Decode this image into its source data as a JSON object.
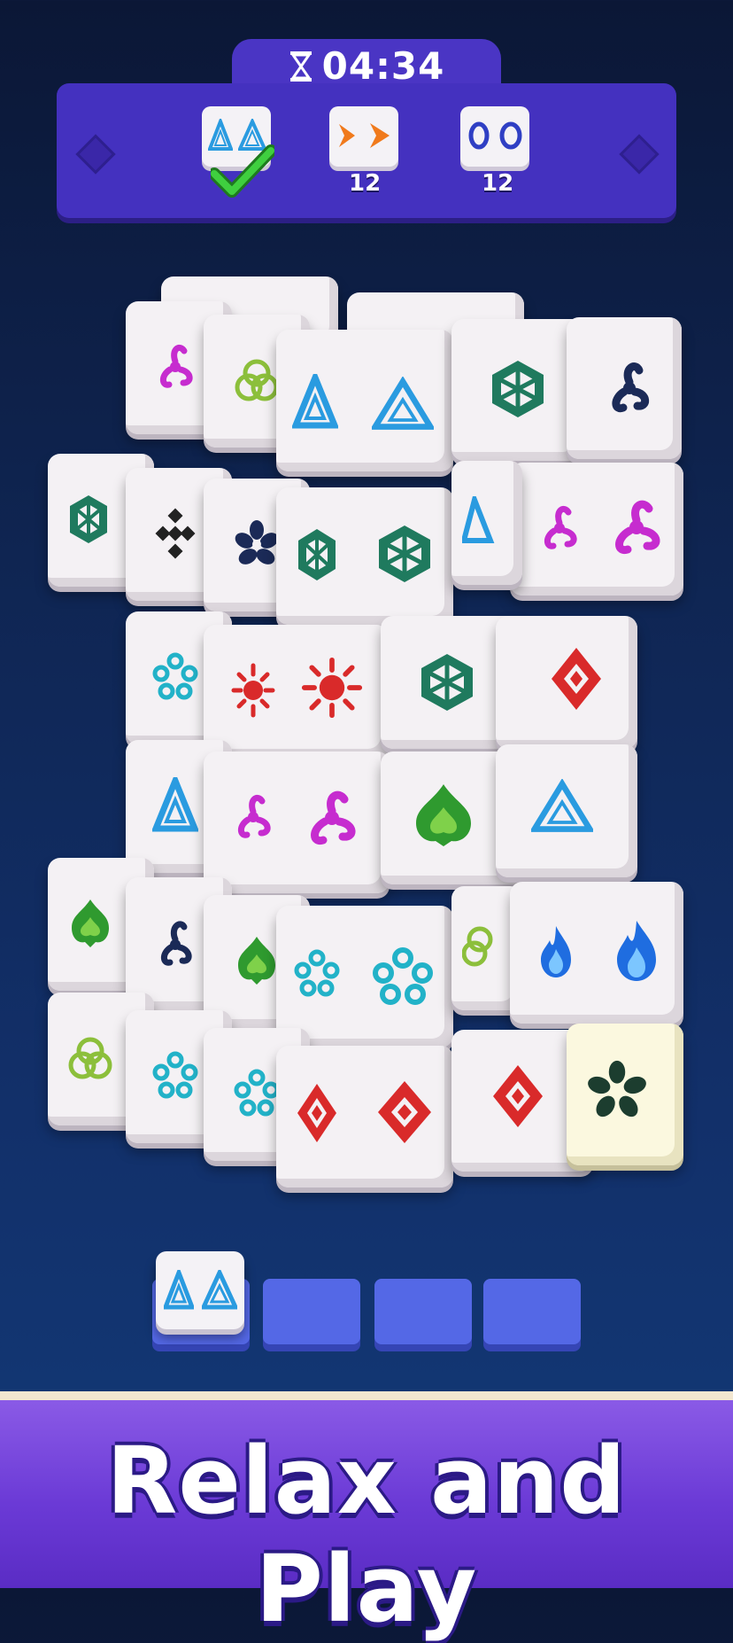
{
  "hud": {
    "timer": "04:34",
    "timer_icon": "hourglass-icon",
    "goals": [
      {
        "symbol": "triangle",
        "count": "",
        "completed": true
      },
      {
        "symbol": "chevron",
        "count": "12",
        "completed": false
      },
      {
        "symbol": "ring",
        "count": "12",
        "completed": false
      }
    ]
  },
  "colors": {
    "panel": "#4431bf",
    "tray_slot": "#5468e6",
    "banner": "#6b3ad6",
    "background": "#0f2552"
  },
  "tray": {
    "slots": 4,
    "filled": [
      "triangle"
    ]
  },
  "banner": {
    "text": "Relax and Play"
  }
}
